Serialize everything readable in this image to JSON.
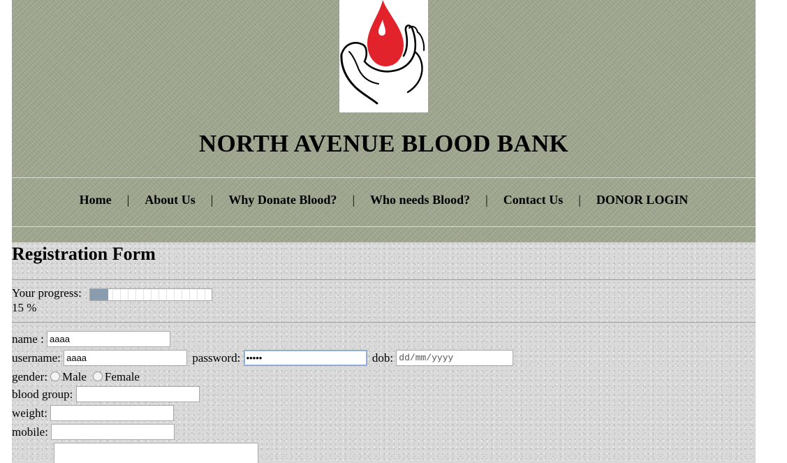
{
  "site": {
    "title": "NORTH AVENUE BLOOD BANK",
    "logo_icon": "blood-drop-hand-icon",
    "logo_colors": {
      "drop": "#e2232b",
      "hand": "#000000"
    }
  },
  "nav": {
    "items": [
      {
        "label": "Home"
      },
      {
        "label": "About Us"
      },
      {
        "label": "Why Donate Blood?"
      },
      {
        "label": "Who needs Blood?"
      },
      {
        "label": "Contact Us"
      },
      {
        "label": "DONOR LOGIN"
      }
    ],
    "separator": "|"
  },
  "form": {
    "title": "Registration Form",
    "progress": {
      "label": "Your progress:",
      "value_percent": 15,
      "percent_text": "15 %",
      "fill_color": "#8a9db0"
    },
    "fields": {
      "name": {
        "label": "name :",
        "value": "aaaa"
      },
      "username": {
        "label": "username:",
        "value": "aaaa"
      },
      "password": {
        "label": "password:",
        "value": "•••••"
      },
      "dob": {
        "label": "dob:",
        "placeholder": "dd/mm/yyyy"
      },
      "gender": {
        "label": "gender:",
        "options": [
          "Male",
          "Female"
        ]
      },
      "blood_group": {
        "label": "blood group:",
        "value": ""
      },
      "weight": {
        "label": "weight:",
        "value": ""
      },
      "mobile": {
        "label": "mobile:",
        "value": ""
      }
    }
  }
}
